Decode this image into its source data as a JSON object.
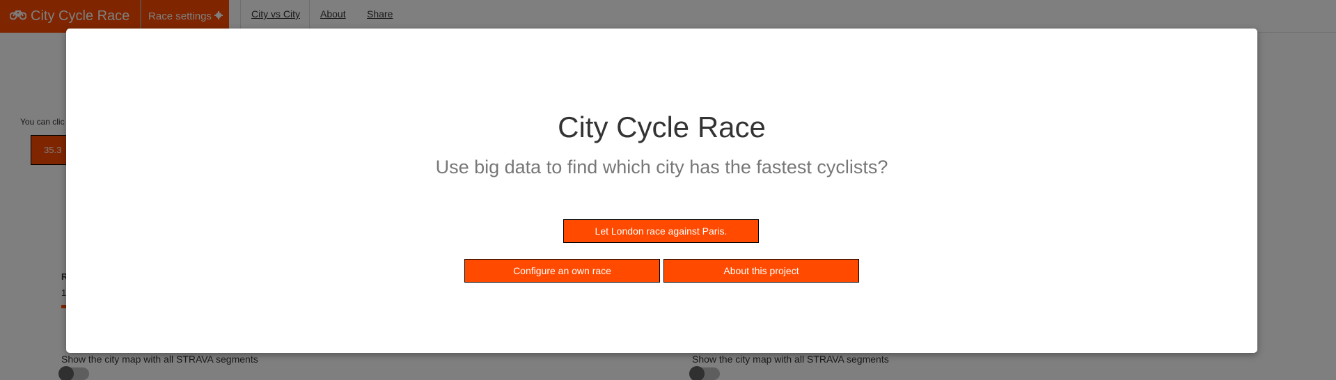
{
  "navbar": {
    "brand": "City Cycle Race",
    "settings_label": "Race settings",
    "links": [
      "City vs City",
      "About",
      "Share"
    ]
  },
  "page": {
    "hint_text": "You can clic",
    "box_value": "35.3",
    "stat_letter": "R",
    "stat_value": "1",
    "map_label_left": "Show the city map with all STRAVA segments",
    "map_label_right": "Show the city map with all STRAVA segments"
  },
  "modal": {
    "title": "City Cycle Race",
    "subtitle": "Use big data to find which city has the fastest cyclists?",
    "buttons": {
      "london_paris": "Let London race against Paris.",
      "configure": "Configure an own race",
      "about": "About this project"
    }
  },
  "colors": {
    "accent": "#ff4a00",
    "overlay": "rgba(0,0,0,0.5)"
  }
}
